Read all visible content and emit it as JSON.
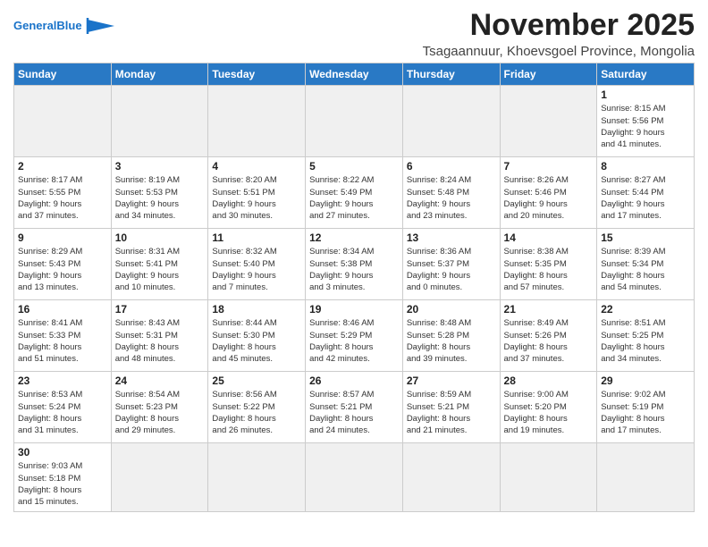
{
  "header": {
    "logo_general": "General",
    "logo_blue": "Blue",
    "month_title": "November 2025",
    "subtitle": "Tsagaannuur, Khoevsgoel Province, Mongolia"
  },
  "weekdays": [
    "Sunday",
    "Monday",
    "Tuesday",
    "Wednesday",
    "Thursday",
    "Friday",
    "Saturday"
  ],
  "weeks": [
    [
      {
        "day": "",
        "info": ""
      },
      {
        "day": "",
        "info": ""
      },
      {
        "day": "",
        "info": ""
      },
      {
        "day": "",
        "info": ""
      },
      {
        "day": "",
        "info": ""
      },
      {
        "day": "",
        "info": ""
      },
      {
        "day": "1",
        "info": "Sunrise: 8:15 AM\nSunset: 5:56 PM\nDaylight: 9 hours\nand 41 minutes."
      }
    ],
    [
      {
        "day": "2",
        "info": "Sunrise: 8:17 AM\nSunset: 5:55 PM\nDaylight: 9 hours\nand 37 minutes."
      },
      {
        "day": "3",
        "info": "Sunrise: 8:19 AM\nSunset: 5:53 PM\nDaylight: 9 hours\nand 34 minutes."
      },
      {
        "day": "4",
        "info": "Sunrise: 8:20 AM\nSunset: 5:51 PM\nDaylight: 9 hours\nand 30 minutes."
      },
      {
        "day": "5",
        "info": "Sunrise: 8:22 AM\nSunset: 5:49 PM\nDaylight: 9 hours\nand 27 minutes."
      },
      {
        "day": "6",
        "info": "Sunrise: 8:24 AM\nSunset: 5:48 PM\nDaylight: 9 hours\nand 23 minutes."
      },
      {
        "day": "7",
        "info": "Sunrise: 8:26 AM\nSunset: 5:46 PM\nDaylight: 9 hours\nand 20 minutes."
      },
      {
        "day": "8",
        "info": "Sunrise: 8:27 AM\nSunset: 5:44 PM\nDaylight: 9 hours\nand 17 minutes."
      }
    ],
    [
      {
        "day": "9",
        "info": "Sunrise: 8:29 AM\nSunset: 5:43 PM\nDaylight: 9 hours\nand 13 minutes."
      },
      {
        "day": "10",
        "info": "Sunrise: 8:31 AM\nSunset: 5:41 PM\nDaylight: 9 hours\nand 10 minutes."
      },
      {
        "day": "11",
        "info": "Sunrise: 8:32 AM\nSunset: 5:40 PM\nDaylight: 9 hours\nand 7 minutes."
      },
      {
        "day": "12",
        "info": "Sunrise: 8:34 AM\nSunset: 5:38 PM\nDaylight: 9 hours\nand 3 minutes."
      },
      {
        "day": "13",
        "info": "Sunrise: 8:36 AM\nSunset: 5:37 PM\nDaylight: 9 hours\nand 0 minutes."
      },
      {
        "day": "14",
        "info": "Sunrise: 8:38 AM\nSunset: 5:35 PM\nDaylight: 8 hours\nand 57 minutes."
      },
      {
        "day": "15",
        "info": "Sunrise: 8:39 AM\nSunset: 5:34 PM\nDaylight: 8 hours\nand 54 minutes."
      }
    ],
    [
      {
        "day": "16",
        "info": "Sunrise: 8:41 AM\nSunset: 5:33 PM\nDaylight: 8 hours\nand 51 minutes."
      },
      {
        "day": "17",
        "info": "Sunrise: 8:43 AM\nSunset: 5:31 PM\nDaylight: 8 hours\nand 48 minutes."
      },
      {
        "day": "18",
        "info": "Sunrise: 8:44 AM\nSunset: 5:30 PM\nDaylight: 8 hours\nand 45 minutes."
      },
      {
        "day": "19",
        "info": "Sunrise: 8:46 AM\nSunset: 5:29 PM\nDaylight: 8 hours\nand 42 minutes."
      },
      {
        "day": "20",
        "info": "Sunrise: 8:48 AM\nSunset: 5:28 PM\nDaylight: 8 hours\nand 39 minutes."
      },
      {
        "day": "21",
        "info": "Sunrise: 8:49 AM\nSunset: 5:26 PM\nDaylight: 8 hours\nand 37 minutes."
      },
      {
        "day": "22",
        "info": "Sunrise: 8:51 AM\nSunset: 5:25 PM\nDaylight: 8 hours\nand 34 minutes."
      }
    ],
    [
      {
        "day": "23",
        "info": "Sunrise: 8:53 AM\nSunset: 5:24 PM\nDaylight: 8 hours\nand 31 minutes."
      },
      {
        "day": "24",
        "info": "Sunrise: 8:54 AM\nSunset: 5:23 PM\nDaylight: 8 hours\nand 29 minutes."
      },
      {
        "day": "25",
        "info": "Sunrise: 8:56 AM\nSunset: 5:22 PM\nDaylight: 8 hours\nand 26 minutes."
      },
      {
        "day": "26",
        "info": "Sunrise: 8:57 AM\nSunset: 5:21 PM\nDaylight: 8 hours\nand 24 minutes."
      },
      {
        "day": "27",
        "info": "Sunrise: 8:59 AM\nSunset: 5:21 PM\nDaylight: 8 hours\nand 21 minutes."
      },
      {
        "day": "28",
        "info": "Sunrise: 9:00 AM\nSunset: 5:20 PM\nDaylight: 8 hours\nand 19 minutes."
      },
      {
        "day": "29",
        "info": "Sunrise: 9:02 AM\nSunset: 5:19 PM\nDaylight: 8 hours\nand 17 minutes."
      }
    ],
    [
      {
        "day": "30",
        "info": "Sunrise: 9:03 AM\nSunset: 5:18 PM\nDaylight: 8 hours\nand 15 minutes."
      },
      {
        "day": "",
        "info": ""
      },
      {
        "day": "",
        "info": ""
      },
      {
        "day": "",
        "info": ""
      },
      {
        "day": "",
        "info": ""
      },
      {
        "day": "",
        "info": ""
      },
      {
        "day": "",
        "info": ""
      }
    ]
  ]
}
